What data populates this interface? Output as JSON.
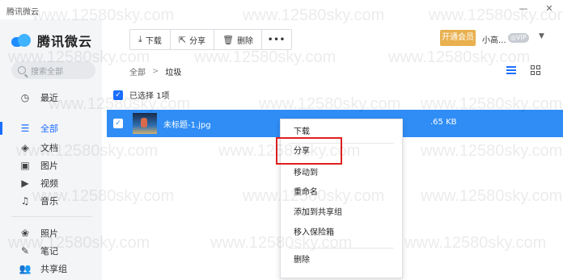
{
  "window": {
    "title": "腾讯微云",
    "min_label": "—",
    "close_label": "✕"
  },
  "sidebar": {
    "logo_text": "腾讯微云",
    "search_placeholder": "搜索全部",
    "items": [
      {
        "label": "最近",
        "icon": "clock-icon",
        "glyph": "◷"
      },
      {
        "label": "全部",
        "icon": "list-icon",
        "glyph": "☰",
        "active": true
      },
      {
        "label": "文档",
        "icon": "layers-icon",
        "glyph": "◈"
      },
      {
        "label": "图片",
        "icon": "image-icon",
        "glyph": "▣"
      },
      {
        "label": "视频",
        "icon": "video-icon",
        "glyph": "▶"
      },
      {
        "label": "音乐",
        "icon": "music-icon",
        "glyph": "♫"
      },
      {
        "label": "照片",
        "icon": "photo-icon",
        "glyph": "❀"
      },
      {
        "label": "笔记",
        "icon": "note-icon",
        "glyph": "✎"
      },
      {
        "label": "共享组",
        "icon": "group-icon",
        "glyph": "👥"
      }
    ]
  },
  "toolbar": {
    "download_label": "下载",
    "share_label": "分享",
    "delete_label": "删除",
    "more_label": "•••"
  },
  "header": {
    "vip_button": "开通会员",
    "user_name": "小高...",
    "vip_badge": "◎VIP",
    "dropdown": "▼"
  },
  "breadcrumb": {
    "root": "全部",
    "separator": ">",
    "current": "垃圾"
  },
  "selection": {
    "text": "已选择 1项"
  },
  "file": {
    "name": "未标题-1.jpg",
    "size": ".65 KB"
  },
  "context_menu": {
    "items": [
      "下载",
      "分享",
      "移动到",
      "重命名",
      "添加到共享组",
      "移入保险箱",
      "删除"
    ],
    "highlighted": "分享"
  },
  "watermark": "www.12580sky.com",
  "colors": {
    "accent": "#1a6eff",
    "selected_row": "#2f8df5",
    "vip": "#e9b04f",
    "highlight_box": "#e02020"
  }
}
